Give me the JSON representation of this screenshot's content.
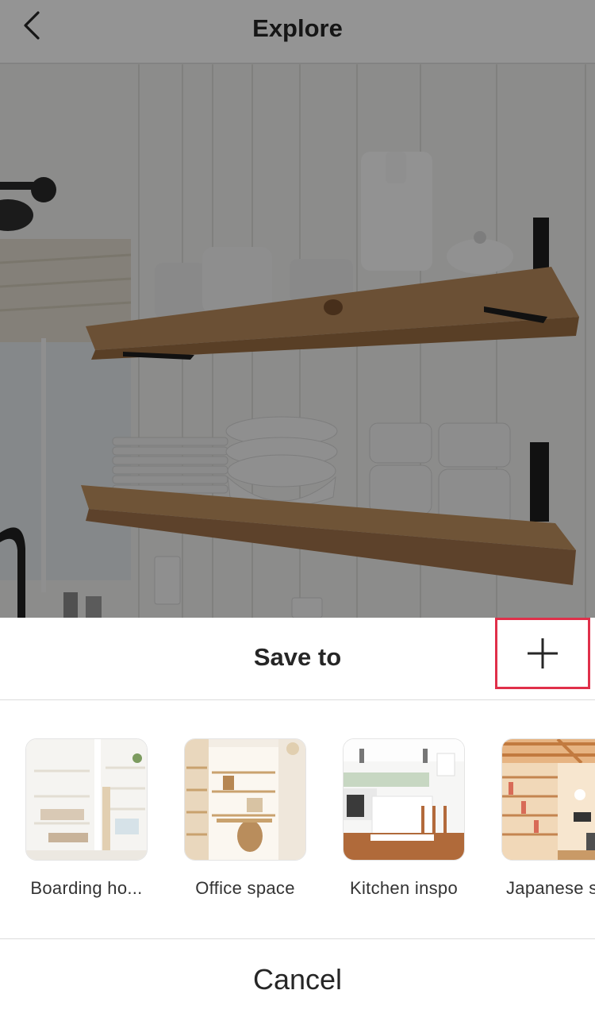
{
  "nav": {
    "title": "Explore",
    "back_icon": "chevron-left-icon"
  },
  "sheet": {
    "title": "Save to",
    "add_icon": "plus-icon",
    "highlight_color": "#e0304a",
    "collections": [
      {
        "label": "Boarding ho..."
      },
      {
        "label": "Office space"
      },
      {
        "label": "Kitchen inspo"
      },
      {
        "label": "Japanese s"
      }
    ],
    "cancel_label": "Cancel"
  }
}
